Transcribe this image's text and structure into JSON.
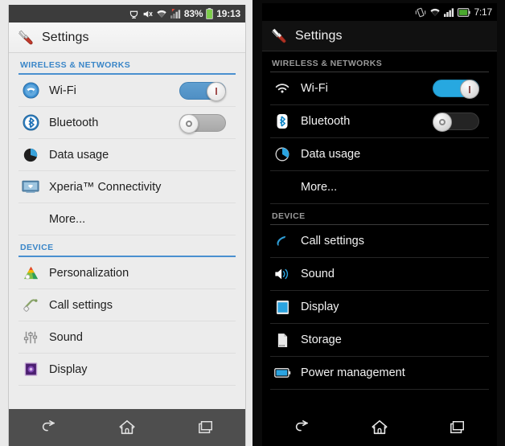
{
  "left_phone": {
    "theme": "light",
    "statusbar": {
      "icons": [
        "usb-debug-icon",
        "mute-icon",
        "wifi-signal-icon",
        "cellular-signal-icon"
      ],
      "battery_percent": "83%",
      "battery_icon": "battery-icon",
      "time": "19:13"
    },
    "actionbar": {
      "icon": "settings-wrench-icon",
      "title": "Settings"
    },
    "sections": [
      {
        "header": "WIRELESS & NETWORKS",
        "rows": [
          {
            "label": "Wi-Fi",
            "icon": "wifi-icon",
            "toggle": "on"
          },
          {
            "label": "Bluetooth",
            "icon": "bluetooth-icon",
            "toggle": "off"
          },
          {
            "label": "Data usage",
            "icon": "data-usage-icon",
            "toggle": null
          },
          {
            "label": "Xperia™ Connectivity",
            "icon": "xperia-connectivity-icon",
            "toggle": null
          },
          {
            "label": "More...",
            "icon": null,
            "toggle": null
          }
        ]
      },
      {
        "header": "DEVICE",
        "rows": [
          {
            "label": "Personalization",
            "icon": "personalization-icon",
            "toggle": null
          },
          {
            "label": "Call settings",
            "icon": "call-settings-icon",
            "toggle": null
          },
          {
            "label": "Sound",
            "icon": "sound-sliders-icon",
            "toggle": null
          },
          {
            "label": "Display",
            "icon": "display-icon",
            "toggle": null
          }
        ]
      }
    ],
    "navbar": {
      "buttons": [
        "back-nav-icon",
        "home-nav-icon",
        "recents-nav-icon"
      ]
    }
  },
  "right_phone": {
    "theme": "dark",
    "statusbar": {
      "icons": [
        "vibrate-icon",
        "wifi-signal-icon",
        "cellular-signal-icon",
        "battery-icon"
      ],
      "battery_percent": "",
      "time": "7:17"
    },
    "actionbar": {
      "icon": "settings-wrench-icon",
      "title": "Settings"
    },
    "sections": [
      {
        "header": "WIRELESS & NETWORKS",
        "rows": [
          {
            "label": "Wi-Fi",
            "icon": "wifi-icon",
            "toggle": "on"
          },
          {
            "label": "Bluetooth",
            "icon": "bluetooth-icon",
            "toggle": "off"
          },
          {
            "label": "Data usage",
            "icon": "data-usage-icon",
            "toggle": null
          },
          {
            "label": "More...",
            "icon": null,
            "toggle": null
          }
        ]
      },
      {
        "header": "DEVICE",
        "rows": [
          {
            "label": "Call settings",
            "icon": "call-settings-icon",
            "toggle": null
          },
          {
            "label": "Sound",
            "icon": "speaker-icon",
            "toggle": null
          },
          {
            "label": "Display",
            "icon": "display-icon",
            "toggle": null
          },
          {
            "label": "Storage",
            "icon": "storage-icon",
            "toggle": null
          },
          {
            "label": "Power management",
            "icon": "battery-management-icon",
            "toggle": null
          }
        ]
      }
    ],
    "navbar": {
      "buttons": [
        "back-nav-icon",
        "home-nav-icon",
        "recents-nav-icon"
      ]
    }
  },
  "colors": {
    "accent_blue": "#4a90d0",
    "toggle_on_dark": "#27a8e0",
    "section_header_light": "#3a86c8",
    "section_header_dark": "#9a9a9a"
  }
}
